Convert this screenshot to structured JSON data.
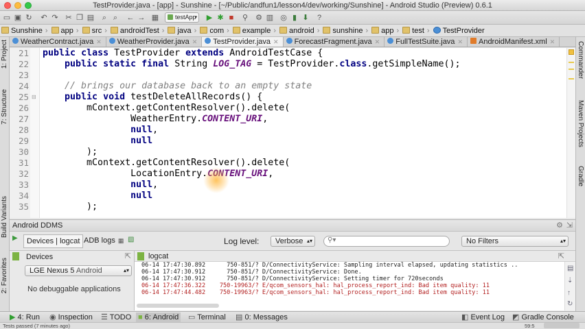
{
  "window": {
    "title": "TestProvider.java - [app] - Sunshine - [~/Public/andfun1/lesson4/dev/working/Sunshine] - Android Studio (Preview) 0.6.1"
  },
  "toolbar": {
    "run_config": "testApp"
  },
  "breadcrumb": [
    "Sunshine",
    "app",
    "src",
    "androidTest",
    "java",
    "com",
    "example",
    "android",
    "sunshine",
    "app",
    "test",
    "TestProvider"
  ],
  "tabs": [
    {
      "label": "WeatherContract.java",
      "active": false
    },
    {
      "label": "WeatherProvider.java",
      "active": false
    },
    {
      "label": "TestProvider.java",
      "active": true
    },
    {
      "label": "ForecastFragment.java",
      "active": false
    },
    {
      "label": "FullTestSuite.java",
      "active": false
    },
    {
      "label": "AndroidManifest.xml",
      "active": false
    }
  ],
  "left_tools": [
    "1: Project",
    "7: Structure",
    "Build Variants",
    "2: Favorites"
  ],
  "right_tools": [
    "Commander",
    "Maven Projects",
    "Gradle"
  ],
  "editor": {
    "lines": [
      {
        "num": "21",
        "text": "public class TestProvider extends AndroidTestCase {"
      },
      {
        "num": "22",
        "text": "    public static final String LOG_TAG = TestProvider.class.getSimpleName();"
      },
      {
        "num": "23",
        "text": ""
      },
      {
        "num": "24",
        "text": "    // brings our database back to an empty state"
      },
      {
        "num": "25",
        "text": "    public void testDeleteAllRecords() {"
      },
      {
        "num": "26",
        "text": "        mContext.getContentResolver().delete("
      },
      {
        "num": "27",
        "text": "                WeatherEntry.CONTENT_URI,"
      },
      {
        "num": "28",
        "text": "                null,"
      },
      {
        "num": "29",
        "text": "                null"
      },
      {
        "num": "30",
        "text": "        );"
      },
      {
        "num": "31",
        "text": "        mContext.getContentResolver().delete("
      },
      {
        "num": "32",
        "text": "                LocationEntry.CONTENT_URI,"
      },
      {
        "num": "33",
        "text": "                null,"
      },
      {
        "num": "34",
        "text": "                null"
      },
      {
        "num": "35",
        "text": "        );"
      }
    ]
  },
  "ddms": {
    "title": "Android DDMS",
    "tab_devices": "Devices | logcat",
    "tab_adb": "ADB logs",
    "log_level_label": "Log level:",
    "log_level_value": "Verbose",
    "search_placeholder": "",
    "filter_value": "No Filters",
    "devices_label": "Devices",
    "device_name": "LGE Nexus 5",
    "device_os": "Android",
    "no_apps": "No debuggable applications",
    "logcat_label": "logcat",
    "log_lines": [
      {
        "text": "06-14 17:47:30.892      750-851/? D/ConnectivityService: Sampling interval elapsed, updating statistics ..",
        "level": "D"
      },
      {
        "text": "06-14 17:47:30.912      750-851/? D/ConnectivityService: Done.",
        "level": "D"
      },
      {
        "text": "06-14 17:47:30.912      750-851/? D/ConnectivityService: Setting timer for 720seconds",
        "level": "D"
      },
      {
        "text": "06-14 17:47:36.322    750-19963/? E/qcom_sensors_hal: hal_process_report_ind: Bad item quality: 11",
        "level": "E"
      },
      {
        "text": "06-14 17:47:44.482    750-19963/? E/qcom_sensors_hal: hal_process_report_ind: Bad item quality: 11",
        "level": "E"
      }
    ]
  },
  "bottom_tools": {
    "run": "4: Run",
    "inspection": "Inspection",
    "todo": "TODO",
    "android": "6: Android",
    "terminal": "Terminal",
    "messages": "0: Messages",
    "event_log": "Event Log",
    "gradle_console": "Gradle Console"
  },
  "status": {
    "message": "Tests passed (7 minutes ago)",
    "position": "59:5"
  },
  "colors": {
    "keyword": "#000080",
    "constant": "#660e7a",
    "comment": "#808080",
    "error_log": "#b21f1f"
  }
}
